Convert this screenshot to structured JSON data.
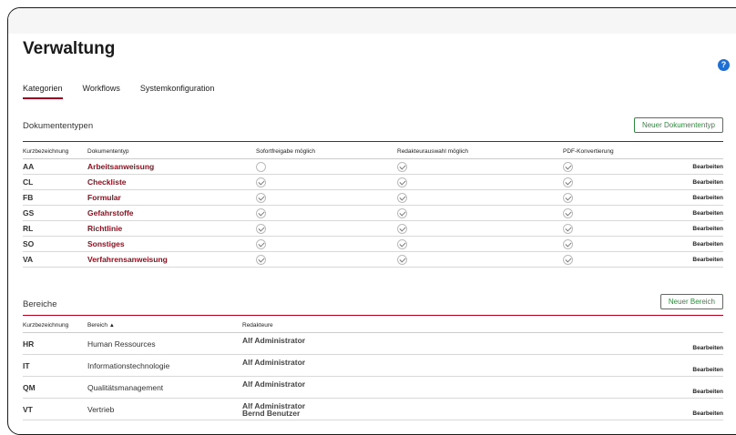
{
  "page": {
    "title": "Verwaltung",
    "help_label": "?"
  },
  "tabs": [
    "Kategorien",
    "Workflows",
    "Systemkonfiguration"
  ],
  "dokumententypen": {
    "title": "Dokumententypen",
    "new_button": "Neuer Dokumententyp",
    "columns": [
      "Kurzbezeichnung",
      "Dokumententyp",
      "Sofortfreigabe möglich",
      "Redakteurauswahl möglich",
      "PDF-Konvertierung"
    ],
    "edit_label": "Bearbeiten",
    "rows": [
      {
        "code": "AA",
        "name": "Arbeitsanweisung",
        "sofort": false,
        "redakteur": true,
        "pdf": true
      },
      {
        "code": "CL",
        "name": "Checkliste",
        "sofort": true,
        "redakteur": true,
        "pdf": true
      },
      {
        "code": "FB",
        "name": "Formular",
        "sofort": true,
        "redakteur": true,
        "pdf": true
      },
      {
        "code": "GS",
        "name": "Gefahrstoffe",
        "sofort": true,
        "redakteur": true,
        "pdf": true
      },
      {
        "code": "RL",
        "name": "Richtlinie",
        "sofort": true,
        "redakteur": true,
        "pdf": true
      },
      {
        "code": "SO",
        "name": "Sonstiges",
        "sofort": true,
        "redakteur": true,
        "pdf": true
      },
      {
        "code": "VA",
        "name": "Verfahrensanweisung",
        "sofort": true,
        "redakteur": true,
        "pdf": true
      }
    ]
  },
  "bereiche": {
    "title": "Bereiche",
    "new_button": "Neuer Bereich",
    "columns": [
      "Kurzbezeichnung",
      "Bereich",
      "Redakteure"
    ],
    "sort_indicator": "▲",
    "edit_label": "Bearbeiten",
    "rows": [
      {
        "code": "HR",
        "name": "Human Ressources",
        "editors": [
          "Alf Administrator"
        ]
      },
      {
        "code": "IT",
        "name": "Informationstechnologie",
        "editors": [
          "Alf Administrator"
        ]
      },
      {
        "code": "QM",
        "name": "Qualitätsmanagement",
        "editors": [
          "Alf Administrator"
        ]
      },
      {
        "code": "VT",
        "name": "Vertrieb",
        "editors": [
          "Alf Administrator",
          "Bernd Benutzer"
        ]
      }
    ]
  },
  "colors": {
    "accent_red": "#b3001b",
    "link_red": "#8a1220",
    "button_green": "#2e8b3d",
    "help_blue": "#1d6fd6"
  }
}
